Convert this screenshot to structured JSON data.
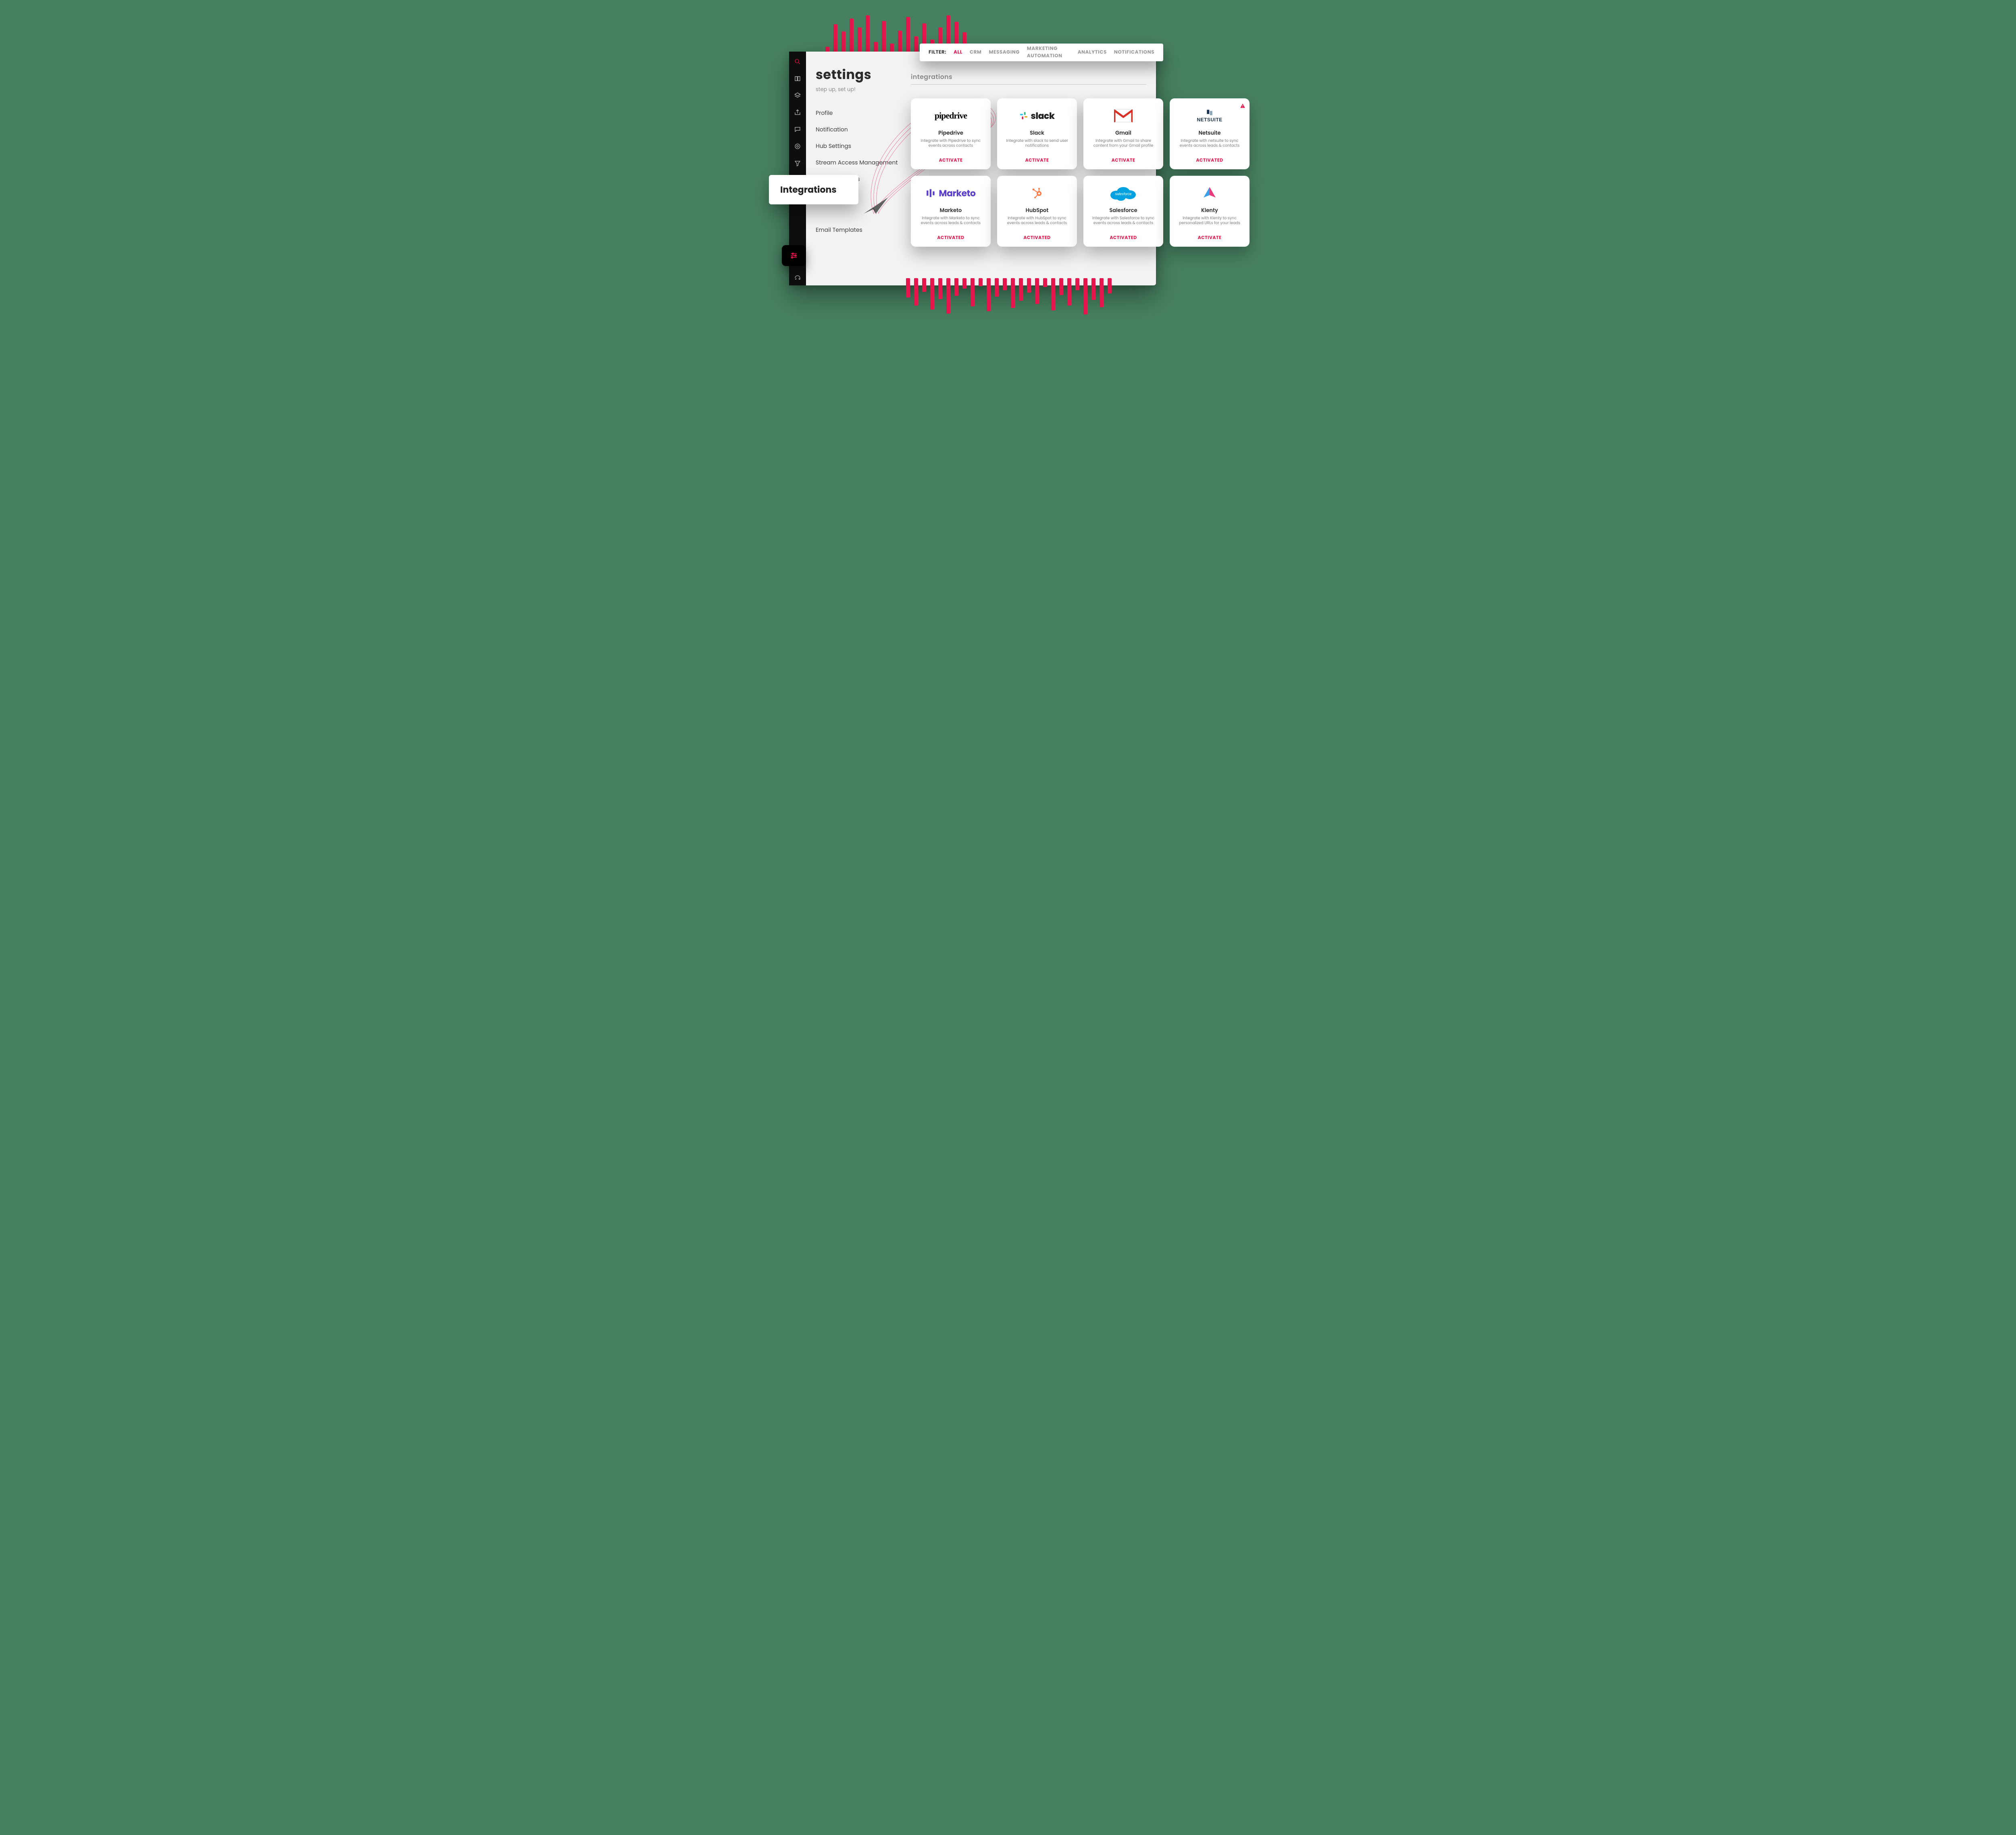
{
  "page": {
    "title": "settings",
    "subtitle": "step up, set up!"
  },
  "sidebar": {
    "items": [
      {
        "label": "Profile"
      },
      {
        "label": "Notification"
      },
      {
        "label": "Hub Settings"
      },
      {
        "label": "Stream Access Management"
      },
      {
        "label": "Distribution lists"
      },
      {
        "label": "Integrations"
      },
      {
        "label": "Email Templates"
      }
    ]
  },
  "hero_chip": "Integrations",
  "section": {
    "title": "integrations"
  },
  "filter": {
    "label": "FILTER:",
    "options": [
      {
        "label": "ALL",
        "active": true
      },
      {
        "label": "CRM"
      },
      {
        "label": "MESSAGING"
      },
      {
        "label": "MARKETING AUTOMATION"
      },
      {
        "label": "ANALYTICS"
      },
      {
        "label": "NOTIFICATIONS"
      }
    ]
  },
  "integrations": [
    {
      "name": "Pipedrive",
      "desc": "Integrate with Pipedrive to sync events across contacts",
      "button": "ACTIVATE",
      "warning": false
    },
    {
      "name": "Slack",
      "desc": "Integrate with slack to send user notifications",
      "button": "ACTIVATE",
      "warning": false
    },
    {
      "name": "Gmail",
      "desc": "Integrate with Gmail to share content from your Gmail profile",
      "button": "ACTIVATE",
      "warning": false
    },
    {
      "name": "Netsuite",
      "desc": "Integrate with netsuite to sync events across leads & contacts",
      "button": "ACTIVATED",
      "warning": true
    },
    {
      "name": "Marketo",
      "desc": "Integrate with Marketo to sync events across leads & contacts",
      "button": "ACTIVATED",
      "warning": false
    },
    {
      "name": "HubSpot",
      "desc": "Integrate with HubSpot to sync events across leads & contacts",
      "button": "ACTIVATED",
      "warning": false
    },
    {
      "name": "Salesforce",
      "desc": "Integrate with Salesforce to sync events across leads & contacts",
      "button": "ACTIVATED",
      "warning": false
    },
    {
      "name": "Klenty",
      "desc": "Integrate with Klenty to sync personalized URLs for your leads",
      "button": "ACTIVATE",
      "warning": false
    }
  ],
  "icons": {
    "rail": [
      "search-icon",
      "book-icon",
      "layer-icon",
      "share-icon",
      "chat-icon",
      "target-icon",
      "filter-icon"
    ],
    "rail_bottom": [
      "sliders-icon",
      "headset-icon"
    ]
  },
  "colors": {
    "accent": "#e6154b",
    "background_green": "#478060"
  }
}
